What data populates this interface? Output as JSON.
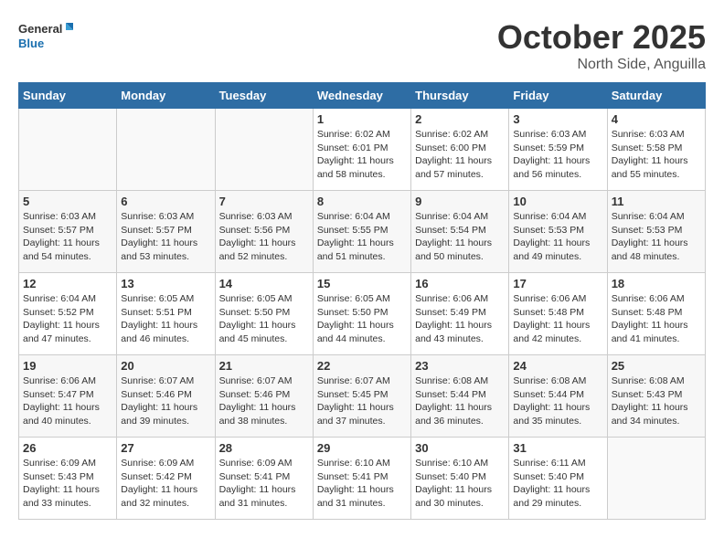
{
  "header": {
    "logo_general": "General",
    "logo_blue": "Blue",
    "month": "October 2025",
    "location": "North Side, Anguilla"
  },
  "days_of_week": [
    "Sunday",
    "Monday",
    "Tuesday",
    "Wednesday",
    "Thursday",
    "Friday",
    "Saturday"
  ],
  "weeks": [
    [
      {
        "day": "",
        "info": ""
      },
      {
        "day": "",
        "info": ""
      },
      {
        "day": "",
        "info": ""
      },
      {
        "day": "1",
        "info": "Sunrise: 6:02 AM\nSunset: 6:01 PM\nDaylight: 11 hours\nand 58 minutes."
      },
      {
        "day": "2",
        "info": "Sunrise: 6:02 AM\nSunset: 6:00 PM\nDaylight: 11 hours\nand 57 minutes."
      },
      {
        "day": "3",
        "info": "Sunrise: 6:03 AM\nSunset: 5:59 PM\nDaylight: 11 hours\nand 56 minutes."
      },
      {
        "day": "4",
        "info": "Sunrise: 6:03 AM\nSunset: 5:58 PM\nDaylight: 11 hours\nand 55 minutes."
      }
    ],
    [
      {
        "day": "5",
        "info": "Sunrise: 6:03 AM\nSunset: 5:57 PM\nDaylight: 11 hours\nand 54 minutes."
      },
      {
        "day": "6",
        "info": "Sunrise: 6:03 AM\nSunset: 5:57 PM\nDaylight: 11 hours\nand 53 minutes."
      },
      {
        "day": "7",
        "info": "Sunrise: 6:03 AM\nSunset: 5:56 PM\nDaylight: 11 hours\nand 52 minutes."
      },
      {
        "day": "8",
        "info": "Sunrise: 6:04 AM\nSunset: 5:55 PM\nDaylight: 11 hours\nand 51 minutes."
      },
      {
        "day": "9",
        "info": "Sunrise: 6:04 AM\nSunset: 5:54 PM\nDaylight: 11 hours\nand 50 minutes."
      },
      {
        "day": "10",
        "info": "Sunrise: 6:04 AM\nSunset: 5:53 PM\nDaylight: 11 hours\nand 49 minutes."
      },
      {
        "day": "11",
        "info": "Sunrise: 6:04 AM\nSunset: 5:53 PM\nDaylight: 11 hours\nand 48 minutes."
      }
    ],
    [
      {
        "day": "12",
        "info": "Sunrise: 6:04 AM\nSunset: 5:52 PM\nDaylight: 11 hours\nand 47 minutes."
      },
      {
        "day": "13",
        "info": "Sunrise: 6:05 AM\nSunset: 5:51 PM\nDaylight: 11 hours\nand 46 minutes."
      },
      {
        "day": "14",
        "info": "Sunrise: 6:05 AM\nSunset: 5:50 PM\nDaylight: 11 hours\nand 45 minutes."
      },
      {
        "day": "15",
        "info": "Sunrise: 6:05 AM\nSunset: 5:50 PM\nDaylight: 11 hours\nand 44 minutes."
      },
      {
        "day": "16",
        "info": "Sunrise: 6:06 AM\nSunset: 5:49 PM\nDaylight: 11 hours\nand 43 minutes."
      },
      {
        "day": "17",
        "info": "Sunrise: 6:06 AM\nSunset: 5:48 PM\nDaylight: 11 hours\nand 42 minutes."
      },
      {
        "day": "18",
        "info": "Sunrise: 6:06 AM\nSunset: 5:48 PM\nDaylight: 11 hours\nand 41 minutes."
      }
    ],
    [
      {
        "day": "19",
        "info": "Sunrise: 6:06 AM\nSunset: 5:47 PM\nDaylight: 11 hours\nand 40 minutes."
      },
      {
        "day": "20",
        "info": "Sunrise: 6:07 AM\nSunset: 5:46 PM\nDaylight: 11 hours\nand 39 minutes."
      },
      {
        "day": "21",
        "info": "Sunrise: 6:07 AM\nSunset: 5:46 PM\nDaylight: 11 hours\nand 38 minutes."
      },
      {
        "day": "22",
        "info": "Sunrise: 6:07 AM\nSunset: 5:45 PM\nDaylight: 11 hours\nand 37 minutes."
      },
      {
        "day": "23",
        "info": "Sunrise: 6:08 AM\nSunset: 5:44 PM\nDaylight: 11 hours\nand 36 minutes."
      },
      {
        "day": "24",
        "info": "Sunrise: 6:08 AM\nSunset: 5:44 PM\nDaylight: 11 hours\nand 35 minutes."
      },
      {
        "day": "25",
        "info": "Sunrise: 6:08 AM\nSunset: 5:43 PM\nDaylight: 11 hours\nand 34 minutes."
      }
    ],
    [
      {
        "day": "26",
        "info": "Sunrise: 6:09 AM\nSunset: 5:43 PM\nDaylight: 11 hours\nand 33 minutes."
      },
      {
        "day": "27",
        "info": "Sunrise: 6:09 AM\nSunset: 5:42 PM\nDaylight: 11 hours\nand 32 minutes."
      },
      {
        "day": "28",
        "info": "Sunrise: 6:09 AM\nSunset: 5:41 PM\nDaylight: 11 hours\nand 31 minutes."
      },
      {
        "day": "29",
        "info": "Sunrise: 6:10 AM\nSunset: 5:41 PM\nDaylight: 11 hours\nand 31 minutes."
      },
      {
        "day": "30",
        "info": "Sunrise: 6:10 AM\nSunset: 5:40 PM\nDaylight: 11 hours\nand 30 minutes."
      },
      {
        "day": "31",
        "info": "Sunrise: 6:11 AM\nSunset: 5:40 PM\nDaylight: 11 hours\nand 29 minutes."
      },
      {
        "day": "",
        "info": ""
      }
    ]
  ]
}
